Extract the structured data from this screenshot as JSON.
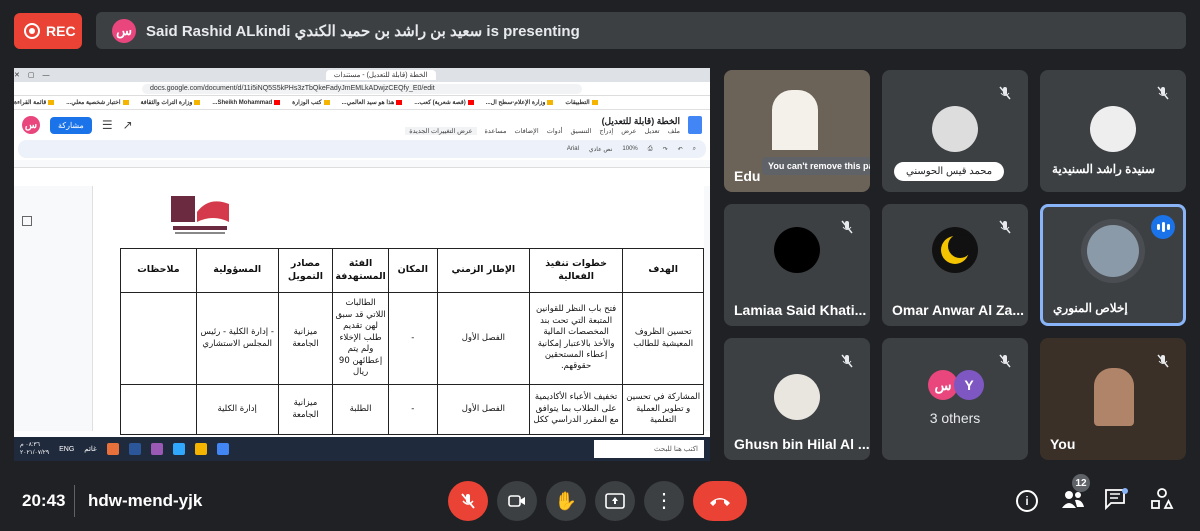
{
  "recording": {
    "label": "REC"
  },
  "presenter_bar": {
    "avatar_letter": "س",
    "text": "Said Rashid ALkindi سعيد بن راشد بن حميد الكندي is presenting"
  },
  "shared_screen": {
    "url": "docs.google.com/document/d/11i5iNQ5S5kPHs3zTbQkeFadyJmEMLkADwjzCEQfy_E0/edit",
    "tab_title": "الخطة (قابلة للتعديل) - مستندات",
    "bookmarks": [
      "التطبيقات",
      "وزارة الإعلام-سطح ال...",
      "(قصة شعرية) كعب...",
      "هذا هو سيد العالمي...",
      "كتب الوزارة",
      "Sheikh Mohammad...",
      "وزارة التراث والثقافة",
      "اختبار شخصية معلي...",
      "قائمة القراءة"
    ],
    "doc_title": "الخطة (قابلة للتعديل)",
    "doc_menu": [
      "ملف",
      "تعديل",
      "عرض",
      "إدراج",
      "التنسيق",
      "أدوات",
      "الإضافات",
      "مساعدة"
    ],
    "view_changes": "عرض التغييرات الجديدة",
    "share_label": "مشاركة",
    "toolbar": {
      "zoom": "100%",
      "style": "نص عادي",
      "font": "Arial"
    },
    "table": {
      "headers": [
        "الهدف",
        "خطوات تنفيذ الفعالية",
        "الإطار الزمني",
        "المكان",
        "الفئة المستهدفة",
        "مصادر التمويل",
        "المسؤولية",
        "ملاحظات"
      ],
      "rows": [
        [
          "تحسين الظروف المعيشية للطالب",
          "فتح باب النظر للقوانين المتبعة التي تحت بند المخصصات المالية والأخذ بالاعتبار إمكانية إعطاء المستحقين حقوقهم.",
          "الفصل الأول",
          "-",
          "الطالبات اللاتي قد سبق لهن تقديم طلب الإخلاء ولم يتم إعطائهن 90 ريال",
          "ميزانية الجامعة",
          "- إدارة الكلية - رئيس المجلس الاستشاري",
          ""
        ],
        [
          "المشاركة في تحسين و تطوير العملية التعلمية",
          "تخفيف الأعباء الأكاديمية على الطلاب بما يتوافق مع المقرر الدراسي ككل",
          "الفصل الأول",
          "-",
          "الطلبة",
          "ميزانية الجامعة",
          "إدارة الكلية",
          ""
        ]
      ]
    },
    "taskbar": {
      "search": "اكتب هنا للبحث",
      "lang": "ENG",
      "weather": "غائم",
      "time": "٠٨:٣٦ م",
      "date": "٢٠٢١/٠٧/٢٩"
    }
  },
  "participants": [
    {
      "id": "edu",
      "name": "Edu",
      "tooltip": "You can't remove this participant",
      "muted": false
    },
    {
      "id": "mohammed",
      "name": "محمد قيس الحوسني",
      "muted": true
    },
    {
      "id": "saida",
      "name": "سنيدة راشد السنيدية",
      "muted": true
    },
    {
      "id": "lamiaa",
      "name": "Lamiaa Said Khati...",
      "muted": true
    },
    {
      "id": "omar",
      "name": "Omar Anwar Al Za...",
      "muted": true
    },
    {
      "id": "ikhlas",
      "name": "إخلاص المنوري",
      "speaking": true
    },
    {
      "id": "ghusn",
      "name": "Ghusn bin Hilal Al ...",
      "muted": true
    },
    {
      "id": "others",
      "name": "3 others",
      "avatar_letters": [
        "س",
        "Y"
      ],
      "muted": true
    },
    {
      "id": "you",
      "name": "You",
      "muted": true
    }
  ],
  "bottom_bar": {
    "time": "20:43",
    "meeting_code": "hdw-mend-yjk",
    "participant_count": "12"
  },
  "colors": {
    "background": "#202124",
    "tile": "#3c4043",
    "red": "#ea4335",
    "blue": "#1a73e8"
  }
}
